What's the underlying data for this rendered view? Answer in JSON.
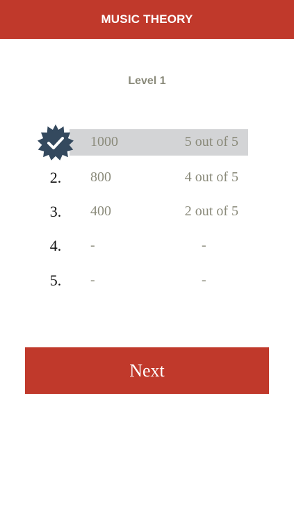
{
  "header": {
    "title": "MUSIC THEORY"
  },
  "level": {
    "title": "Level 1"
  },
  "scores": [
    {
      "rank": "",
      "points": "1000",
      "result": "5 out of 5",
      "current": true,
      "badge_icon": "check-badge-icon"
    },
    {
      "rank": "2.",
      "points": "800",
      "result": "4 out of 5",
      "current": false
    },
    {
      "rank": "3.",
      "points": "400",
      "result": "2 out of 5",
      "current": false
    },
    {
      "rank": "4.",
      "points": "-",
      "result": "-",
      "current": false
    },
    {
      "rank": "5.",
      "points": "-",
      "result": "-",
      "current": false
    }
  ],
  "actions": {
    "next_label": "Next"
  },
  "colors": {
    "accent": "#c0392b",
    "highlight_row": "#d3d4d6",
    "badge": "#34495e",
    "muted_text": "#8a8a7a"
  }
}
